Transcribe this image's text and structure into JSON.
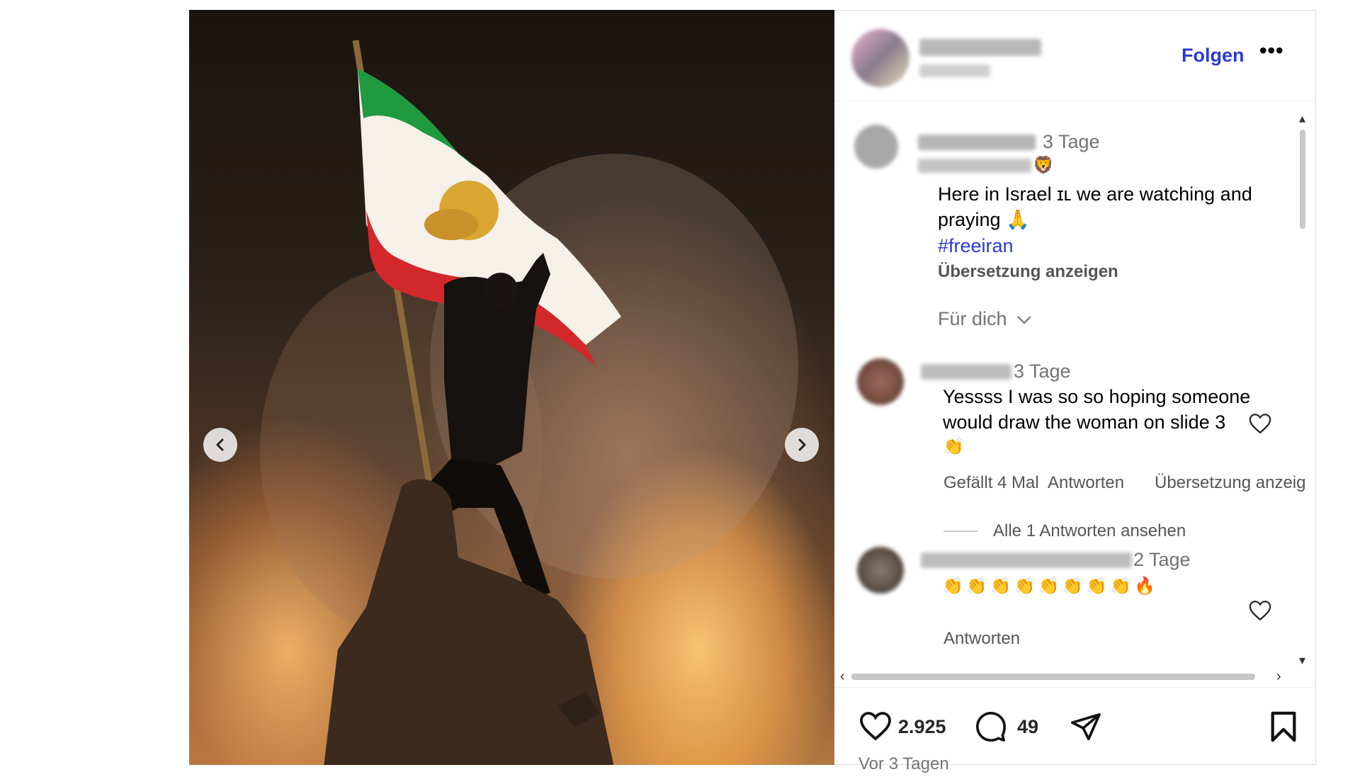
{
  "post": {
    "follow_label": "Folgen",
    "more_label": "•••",
    "caption": {
      "age": "3 Tage",
      "emoji": "🦁",
      "text_line1": "Here in Israel ɪʟ we are watching and",
      "text_line2": "praying 🙏",
      "hashtag": "#freeiran",
      "translate": "Übersetzung anzeigen"
    },
    "filter_label": "Für dich"
  },
  "comments": [
    {
      "age": "3 Tage",
      "line1": "Yessss I was so so hoping someone",
      "line2": "would draw the woman on slide 3",
      "line3": "👏",
      "likes": "Gefällt 4 Mal",
      "reply": "Antworten",
      "translate": "Übersetzung anzeig",
      "view_replies": "Alle 1 Antworten ansehen"
    },
    {
      "age": "2 Tage",
      "text": "👏👏👏👏👏👏👏👏🔥",
      "reply": "Antworten"
    }
  ],
  "actions": {
    "likes_count": "2.925",
    "comments_count": "49",
    "timestamp": "Vor 3 Tagen"
  },
  "icons": {
    "prev": "chevron-left-icon",
    "next": "chevron-right-icon",
    "like": "heart-icon",
    "comment": "comment-bubble-icon",
    "share": "paper-plane-icon",
    "save": "bookmark-icon"
  },
  "colors": {
    "link_blue": "#2b3bd0",
    "muted_text": "#737373"
  }
}
